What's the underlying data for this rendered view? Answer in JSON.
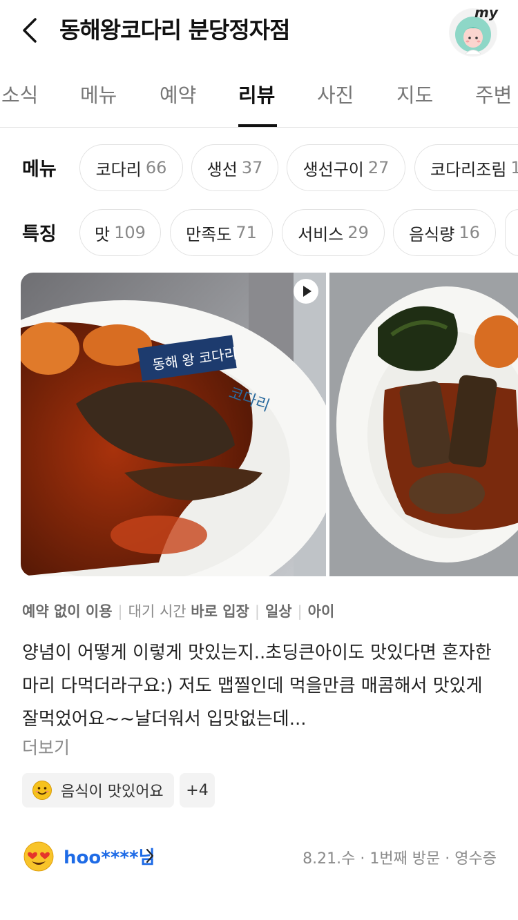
{
  "header": {
    "title": "동해왕코다리 분당정자점",
    "my_label": "my"
  },
  "tabs": [
    {
      "label": "소식"
    },
    {
      "label": "메뉴"
    },
    {
      "label": "예약"
    },
    {
      "label": "리뷰",
      "active": true
    },
    {
      "label": "사진"
    },
    {
      "label": "지도"
    },
    {
      "label": "주변"
    }
  ],
  "filters": {
    "menu": {
      "label": "메뉴",
      "chips": [
        {
          "name": "코다리",
          "count": "66"
        },
        {
          "name": "생선",
          "count": "37"
        },
        {
          "name": "생선구이",
          "count": "27"
        },
        {
          "name": "코다리조림",
          "count": "1"
        }
      ]
    },
    "feature": {
      "label": "특징",
      "chips": [
        {
          "name": "맛",
          "count": "109"
        },
        {
          "name": "만족도",
          "count": "71"
        },
        {
          "name": "서비스",
          "count": "29"
        },
        {
          "name": "음식량",
          "count": "16"
        }
      ]
    }
  },
  "photo1": {
    "flag_text": "동해 왕 코다리",
    "plate_logo": "코다리"
  },
  "review": {
    "tags": [
      {
        "text": "예약 없이 이용",
        "strong": true
      },
      {
        "text": "대기 시간",
        "value": "바로 입장"
      },
      {
        "text": "일상",
        "strong": true
      },
      {
        "text": "아이",
        "strong": true
      }
    ],
    "text_line1": "양념이 어떻게 이렇게 맛있는지..초딩큰아이도 맛있다면 혼자한",
    "text_line2": "마리 다먹더라구요:) 저도 맵찔인데 먹을만큼 매콤해서 맛있게",
    "text_line3": "잘먹었어요~~날더워서 입맛없는데...",
    "more_label": "더보기",
    "keyword": "음식이 맛있어요",
    "keyword_more": "+4",
    "author": "hoo****님",
    "meta": "8.21.수 · 1번째 방문 · 영수증"
  },
  "colors": {
    "accent_blue": "#1e6be6",
    "text_gray": "#8a8a8a",
    "chip_border": "#e2e2e2"
  }
}
